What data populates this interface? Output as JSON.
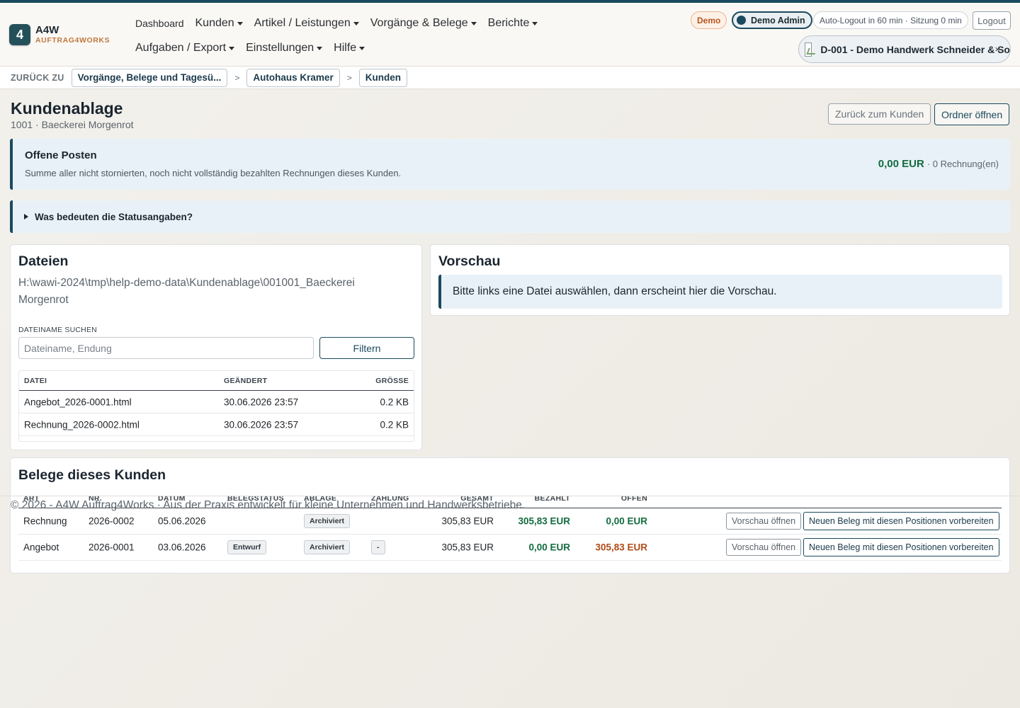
{
  "brand": {
    "badge": "4",
    "title": "A4W",
    "subtitle": "AUFTRAG4WORKS"
  },
  "nav": {
    "row1": [
      {
        "label": "Dashboard",
        "dropdown": false
      },
      {
        "label": "Kunden",
        "dropdown": true
      },
      {
        "label": "Artikel / Leistungen",
        "dropdown": true
      },
      {
        "label": "Vorgänge & Belege",
        "dropdown": true
      },
      {
        "label": "Berichte",
        "dropdown": true
      }
    ],
    "row2": [
      {
        "label": "Aufgaben / Export",
        "dropdown": true
      },
      {
        "label": "Einstellungen",
        "dropdown": true
      },
      {
        "label": "Hilfe",
        "dropdown": true
      }
    ]
  },
  "header": {
    "demo_badge": "Demo",
    "user": "Demo Admin",
    "session_info": "Auto-Logout in 60 min · Sitzung 0 min",
    "logout": "Logout",
    "company": "D-001 - Demo Handwerk Schneider & So",
    "company_close": "×"
  },
  "breadcrumb": {
    "label": "ZURÜCK ZU",
    "items": [
      "Vorgänge, Belege und Tagesü...",
      "Autohaus Kramer",
      "Kunden"
    ],
    "separator": ">"
  },
  "page": {
    "title": "Kundenablage",
    "subtitle": "1001 · Baeckerei Morgenrot",
    "back_button": "Zurück zum Kunden",
    "open_folder_button": "Ordner öffnen"
  },
  "open_items": {
    "title": "Offene Posten",
    "description": "Summe aller nicht stornierten, noch nicht vollständig bezahlten Rechnungen dieses Kunden.",
    "amount": "0,00 EUR",
    "count": "· 0 Rechnung(en)"
  },
  "status_help": {
    "label": "Was bedeuten die Statusangaben?"
  },
  "files": {
    "title": "Dateien",
    "path": "H:\\wawi-2024\\tmp\\help-demo-data\\Kundenablage\\001001_Baeckerei Morgenrot",
    "search_label": "DATEINAME SUCHEN",
    "search_placeholder": "Dateiname, Endung",
    "search_value": "",
    "filter_button": "Filtern",
    "columns": [
      "DATEI",
      "GEÄNDERT",
      "GRÖSSE"
    ],
    "rows": [
      [
        "Angebot_2026-0001.html",
        "30.06.2026 23:57",
        "0.2 KB"
      ],
      [
        "Rechnung_2026-0002.html",
        "30.06.2026 23:57",
        "0.2 KB"
      ]
    ]
  },
  "preview": {
    "title": "Vorschau",
    "hint": "Bitte links eine Datei auswählen, dann erscheint hier die Vorschau."
  },
  "docs": {
    "title": "Belege dieses Kunden",
    "columns": [
      "ART",
      "NR.",
      "DATUM",
      "BELEGSTATUS",
      "ABLAGE",
      "ZAHLUNG",
      "GESAMT",
      "BEZAHLT",
      "OFFEN"
    ],
    "rows": [
      {
        "art": "Rechnung",
        "nr": "2026-0002",
        "datum": "05.06.2026",
        "status": "",
        "ablage": "Archiviert",
        "zahlung": "",
        "gesamt": "305,83 EUR",
        "bezahlt": "305,83 EUR",
        "offen": "0,00 EUR"
      },
      {
        "art": "Angebot",
        "nr": "2026-0001",
        "datum": "03.06.2026",
        "status": "Entwurf",
        "ablage": "Archiviert",
        "zahlung": "-",
        "gesamt": "305,83 EUR",
        "bezahlt": "0,00 EUR",
        "offen": "305,83 EUR"
      }
    ],
    "preview_button": "Vorschau öffnen",
    "new_doc_button": "Neuen Beleg mit diesen Positionen vorbereiten"
  },
  "footer": {
    "text": "© 2026 - A4W Auftrag4Works · Aus der Praxis entwickelt für kleine Unternehmen und Handwerksbetriebe."
  },
  "colors": {
    "primary": "#1b4a5e",
    "accent": "#c0783f",
    "positive": "#126b3e",
    "warning": "#b04a15",
    "info_bg": "#e9f1f8"
  }
}
